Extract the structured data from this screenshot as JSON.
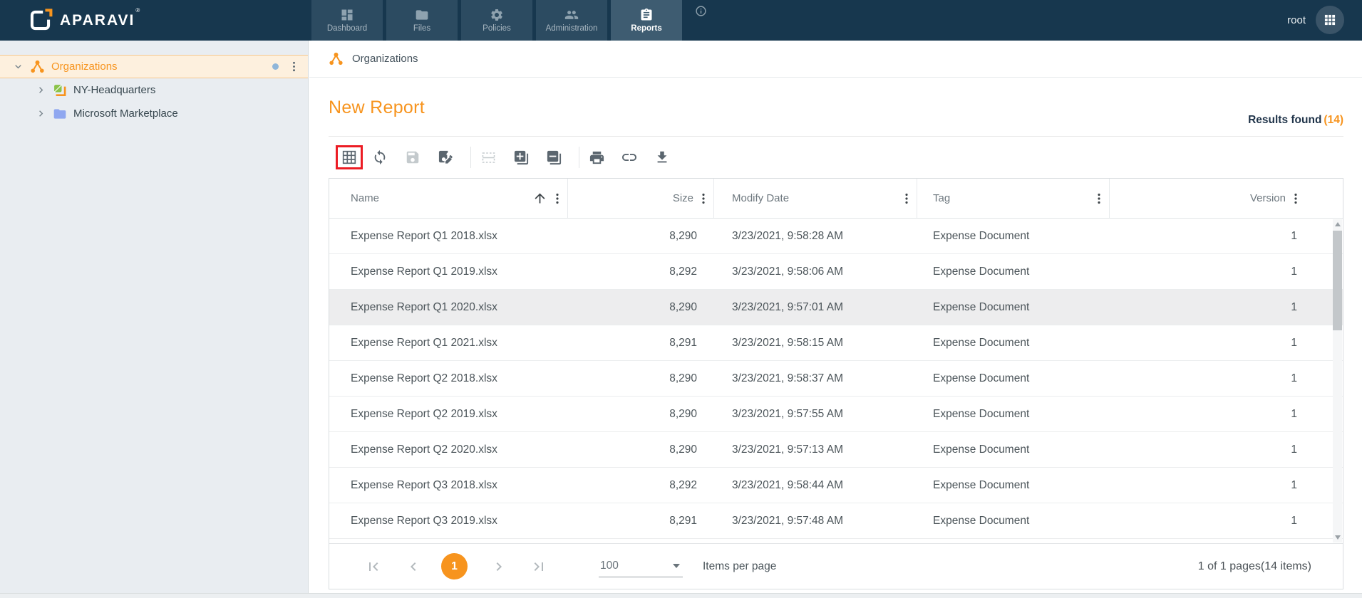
{
  "nav": {
    "logo_text": "APARAVI",
    "logo_reg": "®",
    "tabs": [
      {
        "label": "Dashboard",
        "icon": "dashboard-icon",
        "selected": false
      },
      {
        "label": "Files",
        "icon": "folder-icon",
        "selected": false
      },
      {
        "label": "Policies",
        "icon": "gear-icon",
        "selected": false
      },
      {
        "label": "Administration",
        "icon": "people-icon",
        "selected": false
      },
      {
        "label": "Reports",
        "icon": "clipboard-icon",
        "selected": true
      }
    ],
    "user": "root"
  },
  "sidebar": {
    "items": [
      {
        "label": "Organizations",
        "icon": "organization-icon",
        "selected": true,
        "expanded": true
      },
      {
        "label": "NY-Headquarters",
        "icon": "aggregator-icon",
        "selected": false,
        "expanded": false
      },
      {
        "label": "Microsoft Marketplace",
        "icon": "folder-icon",
        "selected": false,
        "expanded": false
      }
    ]
  },
  "breadcrumb": {
    "label": "Organizations",
    "icon": "organization-icon"
  },
  "page": {
    "title": "New Report",
    "results_label": "Results found",
    "results_count": "(14)"
  },
  "toolbar": {
    "icons": [
      "table-columns",
      "refresh",
      "save",
      "save-edit",
      "row-layout",
      "expand-all",
      "collapse-all",
      "print",
      "link",
      "download"
    ],
    "highlighted_icon": "table-columns",
    "highlight_color": "#ec1c24",
    "disabled_icons": [
      "save",
      "row-layout"
    ]
  },
  "table": {
    "columns": [
      {
        "label": "Name",
        "sort": "asc"
      },
      {
        "label": "Size"
      },
      {
        "label": "Modify Date"
      },
      {
        "label": "Tag"
      },
      {
        "label": "Version"
      }
    ],
    "rows": [
      {
        "name": "Expense Report Q1 2018.xlsx",
        "size": "8,290",
        "modify_date": "3/23/2021, 9:58:28 AM",
        "tag": "Expense Document",
        "version": "1",
        "highlighted": false
      },
      {
        "name": "Expense Report Q1 2019.xlsx",
        "size": "8,292",
        "modify_date": "3/23/2021, 9:58:06 AM",
        "tag": "Expense Document",
        "version": "1",
        "highlighted": false
      },
      {
        "name": "Expense Report Q1 2020.xlsx",
        "size": "8,290",
        "modify_date": "3/23/2021, 9:57:01 AM",
        "tag": "Expense Document",
        "version": "1",
        "highlighted": true
      },
      {
        "name": "Expense Report Q1 2021.xlsx",
        "size": "8,291",
        "modify_date": "3/23/2021, 9:58:15 AM",
        "tag": "Expense Document",
        "version": "1",
        "highlighted": false
      },
      {
        "name": "Expense Report Q2 2018.xlsx",
        "size": "8,290",
        "modify_date": "3/23/2021, 9:58:37 AM",
        "tag": "Expense Document",
        "version": "1",
        "highlighted": false
      },
      {
        "name": "Expense Report Q2 2019.xlsx",
        "size": "8,290",
        "modify_date": "3/23/2021, 9:57:55 AM",
        "tag": "Expense Document",
        "version": "1",
        "highlighted": false
      },
      {
        "name": "Expense Report Q2 2020.xlsx",
        "size": "8,290",
        "modify_date": "3/23/2021, 9:57:13 AM",
        "tag": "Expense Document",
        "version": "1",
        "highlighted": false
      },
      {
        "name": "Expense Report Q3 2018.xlsx",
        "size": "8,292",
        "modify_date": "3/23/2021, 9:58:44 AM",
        "tag": "Expense Document",
        "version": "1",
        "highlighted": false
      },
      {
        "name": "Expense Report Q3 2019.xlsx",
        "size": "8,291",
        "modify_date": "3/23/2021, 9:57:48 AM",
        "tag": "Expense Document",
        "version": "1",
        "highlighted": false
      }
    ]
  },
  "pagination": {
    "current_page": "1",
    "items_per_page": "100",
    "items_per_page_label": "Items per page",
    "summary": "1 of 1 pages(14 items)"
  },
  "colors": {
    "accent_orange": "#f7941e",
    "nav_bg": "#17374e",
    "sidebar_bg": "#e9edf1",
    "selected_tree_bg": "#fdf0de",
    "highlight_red": "#ec1c24",
    "highlighted_row_bg": "#ededee"
  }
}
